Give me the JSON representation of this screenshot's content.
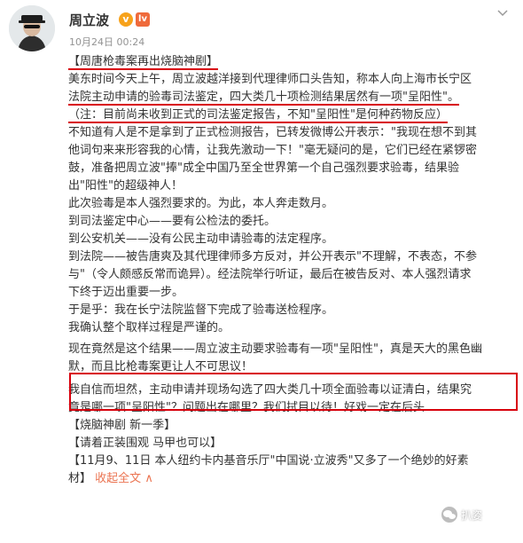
{
  "header": {
    "name": "周立波",
    "time": "10月24日 00:24",
    "verified_badge": "v",
    "level_badge": "lv"
  },
  "post": {
    "lines": [
      "【周唐枪毒案再出烧脑神剧】",
      "美东时间今天上午，周立波越洋接到代理律师口头告知，称本人向上海市长宁区",
      "法院主动申请的验毒司法鉴定，四大类几十项检测结果居然有一项\"呈阳性\"。",
      "（注：目前尚未收到正式的司法鉴定报告，不知\"呈阳性\"是何种药物反应）",
      "不知道有人是不是拿到了正式检测报告，已转发微博公开表示：\"我现在想不到其",
      "他词句来来形容我的心情，让我先激动一下！\"毫无疑问的是，它们已经在紧锣密",
      "鼓，准备把周立波\"捧\"成全中国乃至全世界第一个自己强烈要求验毒，结果验",
      "出\"阳性\"的超级神人！",
      "此次验毒是本人强烈要求的。为此，本人奔走数月。",
      "到司法鉴定中心——要有公检法的委托。",
      "到公安机关——没有公民主动申请验毒的法定程序。",
      "到法院——被告唐爽及其代理律师多方反对，并公开表示\"不理解，不表态，不参",
      "与\"（令人颇感反常而诡异）。经法院举行听证，最后在被告反对、本人强烈请求",
      "下终于迈出重要一步。",
      "于是乎：我在长宁法院监督下完成了验毒送检程序。",
      "我确认整个取样过程是严谨的。",
      "现在竟然是这个结果——周立波主动要求验毒有一项\"呈阳性\"，真是天大的黑色幽",
      "默，而且比枪毒案更让人不可思议！",
      "我自信而坦然，主动申请并现场勾选了四大类几十项全面验毒以证清白，结果究",
      "竟是哪一项\"呈阳性\"？问题出在哪里？我们拭目以待！好戏一定在后头……",
      "【烧脑神剧 新一季】",
      "【请着正装围观 马甲也可以】",
      "【11月9、11日 本人纽约卡内基音乐厅\"中国说·立波秀\"又多了一个绝妙的好素",
      "材】"
    ],
    "collapse_link": "收起全文",
    "collapse_arrow": "∧"
  },
  "watermark": "扒姿"
}
